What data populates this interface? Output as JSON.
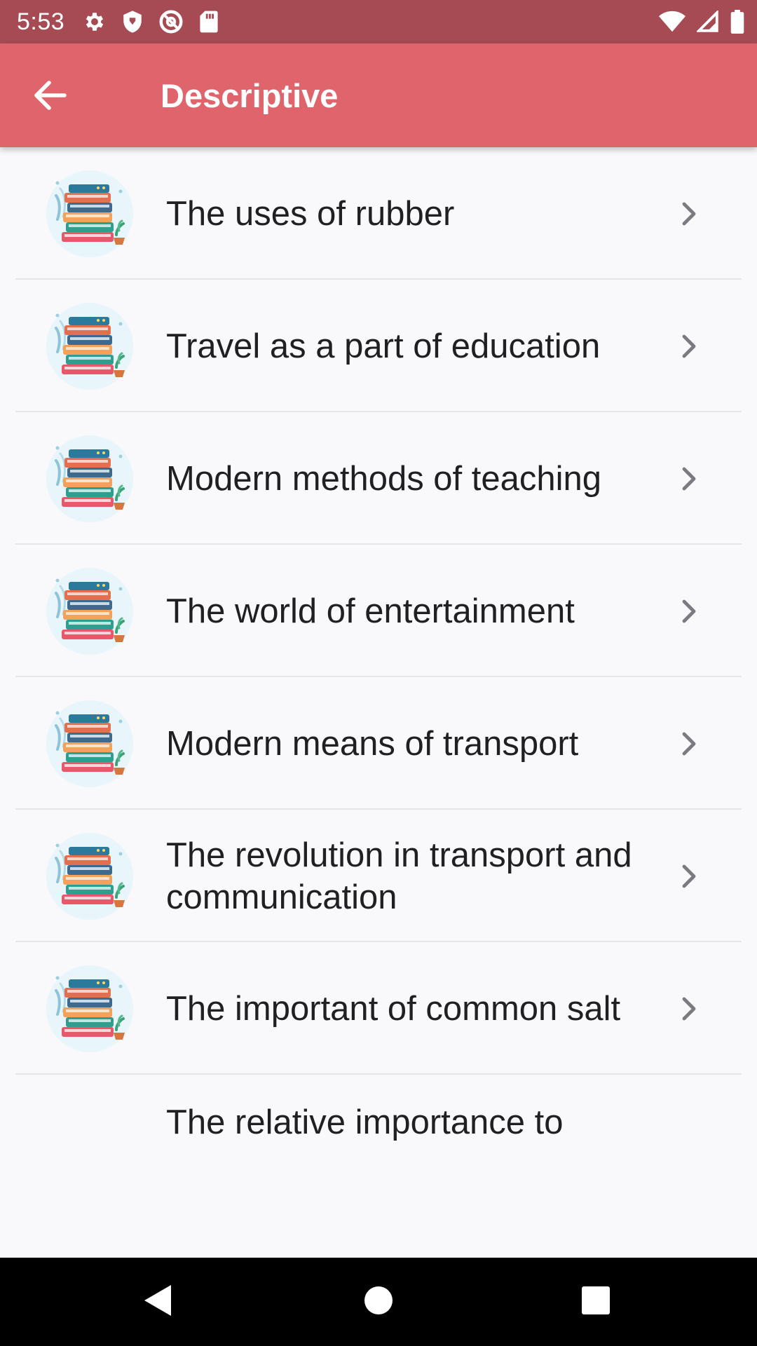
{
  "status_bar": {
    "time": "5:53",
    "icons_left": [
      "settings-icon",
      "shield-icon",
      "at-sign-icon",
      "sd-card-icon"
    ],
    "icons_right": [
      "wifi-icon",
      "signal-icon",
      "battery-icon"
    ]
  },
  "app_bar": {
    "title": "Descriptive",
    "back_icon": "arrow-left-icon"
  },
  "list": {
    "items": [
      {
        "label": "The uses of rubber"
      },
      {
        "label": "Travel as a part of education"
      },
      {
        "label": "Modern methods of teaching"
      },
      {
        "label": "The world of entertainment"
      },
      {
        "label": "Modern means of transport"
      },
      {
        "label": "The revolution in transport and communication"
      },
      {
        "label": "The important of common salt"
      },
      {
        "label": "The relative importance to"
      }
    ],
    "thumbnail_icon": "books-stack-icon",
    "chevron_icon": "chevron-right-icon"
  },
  "nav_bar": {
    "buttons": [
      "back-triangle-icon",
      "home-circle-icon",
      "recents-square-icon"
    ]
  },
  "colors": {
    "status_bar": "#a64a53",
    "app_bar": "#e0646b",
    "background": "#f9f9fc",
    "text": "#1f1f24",
    "divider": "#e6e6ea",
    "chevron": "#7a7a80"
  }
}
